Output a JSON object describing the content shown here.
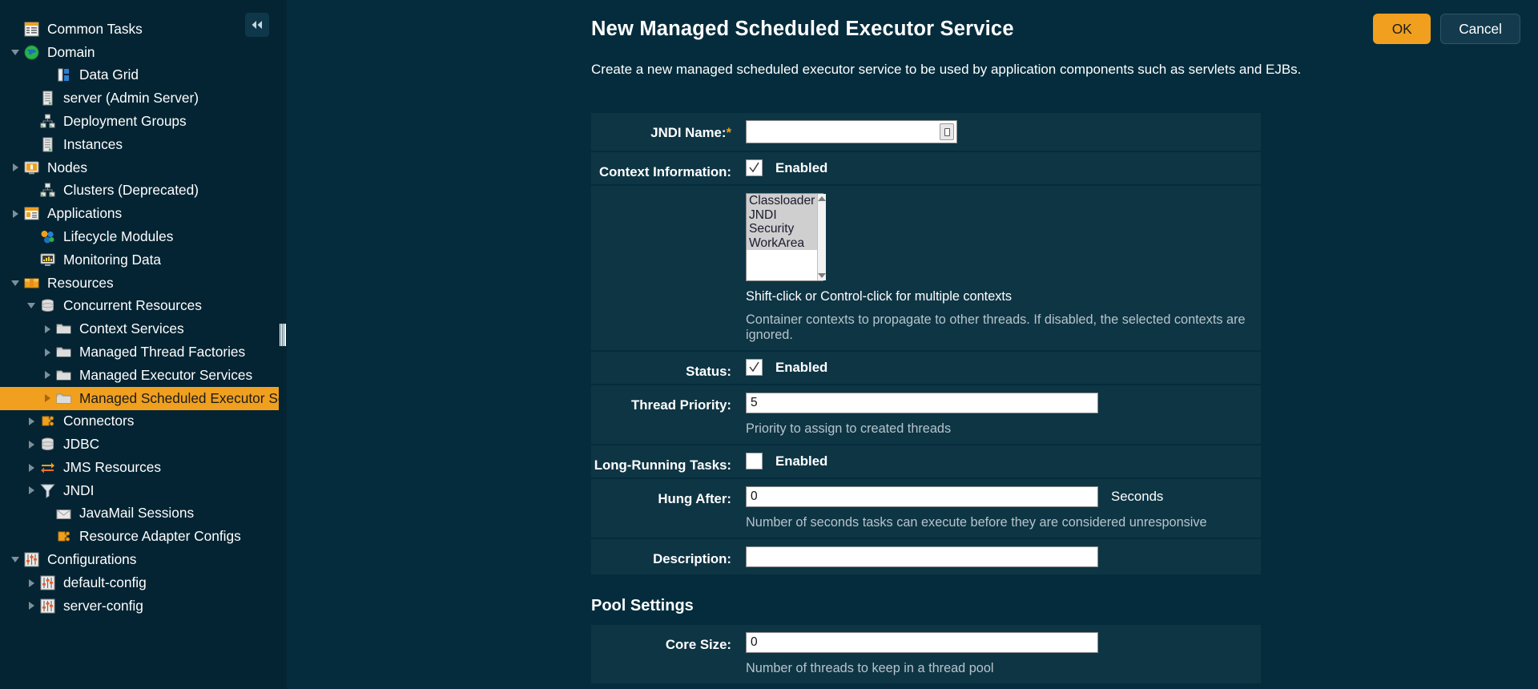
{
  "sidebar": {
    "collapse_icon": "chevron-double-left-icon",
    "items": [
      {
        "label": "Common Tasks",
        "icon": "tasks-icon",
        "indent": 0,
        "twisty": "none",
        "selected": false
      },
      {
        "label": "Domain",
        "icon": "globe-icon",
        "indent": 0,
        "twisty": "expanded",
        "selected": false
      },
      {
        "label": "Data Grid",
        "icon": "datagrid-icon",
        "indent": 2,
        "twisty": "none",
        "selected": false
      },
      {
        "label": "server (Admin Server)",
        "icon": "server-icon",
        "indent": 1,
        "twisty": "none",
        "selected": false
      },
      {
        "label": "Deployment Groups",
        "icon": "group-icon",
        "indent": 1,
        "twisty": "none",
        "selected": false
      },
      {
        "label": "Instances",
        "icon": "server-icon",
        "indent": 1,
        "twisty": "none",
        "selected": false
      },
      {
        "label": "Nodes",
        "icon": "node-icon",
        "indent": 0,
        "twisty": "collapsed",
        "selected": false
      },
      {
        "label": "Clusters (Deprecated)",
        "icon": "group-icon",
        "indent": 1,
        "twisty": "none",
        "selected": false
      },
      {
        "label": "Applications",
        "icon": "application-icon",
        "indent": 0,
        "twisty": "collapsed",
        "selected": false
      },
      {
        "label": "Lifecycle Modules",
        "icon": "lifecycle-icon",
        "indent": 1,
        "twisty": "none",
        "selected": false
      },
      {
        "label": "Monitoring Data",
        "icon": "monitor-icon",
        "indent": 1,
        "twisty": "none",
        "selected": false
      },
      {
        "label": "Resources",
        "icon": "resources-icon",
        "indent": 0,
        "twisty": "expanded",
        "selected": false
      },
      {
        "label": "Concurrent Resources",
        "icon": "database-icon",
        "indent": 1,
        "twisty": "expanded",
        "selected": false
      },
      {
        "label": "Context Services",
        "icon": "folder-icon",
        "indent": 2,
        "twisty": "collapsed",
        "selected": false
      },
      {
        "label": "Managed Thread Factories",
        "icon": "folder-icon",
        "indent": 2,
        "twisty": "collapsed",
        "selected": false
      },
      {
        "label": "Managed Executor Services",
        "icon": "folder-icon",
        "indent": 2,
        "twisty": "collapsed",
        "selected": false
      },
      {
        "label": "Managed Scheduled Executor Services",
        "icon": "folder-icon",
        "indent": 2,
        "twisty": "collapsed",
        "selected": true
      },
      {
        "label": "Connectors",
        "icon": "connector-icon",
        "indent": 1,
        "twisty": "collapsed",
        "selected": false
      },
      {
        "label": "JDBC",
        "icon": "database-icon",
        "indent": 1,
        "twisty": "collapsed",
        "selected": false
      },
      {
        "label": "JMS Resources",
        "icon": "jms-icon",
        "indent": 1,
        "twisty": "collapsed",
        "selected": false
      },
      {
        "label": "JNDI",
        "icon": "funnel-icon",
        "indent": 1,
        "twisty": "collapsed",
        "selected": false
      },
      {
        "label": "JavaMail Sessions",
        "icon": "mail-icon",
        "indent": 2,
        "twisty": "none",
        "selected": false
      },
      {
        "label": "Resource Adapter Configs",
        "icon": "connector-icon",
        "indent": 2,
        "twisty": "none",
        "selected": false
      },
      {
        "label": "Configurations",
        "icon": "config-icon",
        "indent": 0,
        "twisty": "expanded",
        "selected": false
      },
      {
        "label": "default-config",
        "icon": "config-icon",
        "indent": 1,
        "twisty": "collapsed",
        "selected": false
      },
      {
        "label": "server-config",
        "icon": "config-icon",
        "indent": 1,
        "twisty": "collapsed",
        "selected": false
      }
    ]
  },
  "header": {
    "title": "New Managed Scheduled Executor Service",
    "description": "Create a new managed scheduled executor service to be used by application components such as servlets and EJBs.",
    "ok_label": "OK",
    "cancel_label": "Cancel"
  },
  "form": {
    "jndi_name": {
      "label": "JNDI Name:",
      "required_marker": "*",
      "value": "",
      "placeholder": ""
    },
    "context_information": {
      "label": "Context Information:",
      "checkbox_label": "Enabled",
      "checked": true
    },
    "contexts": {
      "options": [
        "Classloader",
        "JNDI",
        "Security",
        "WorkArea"
      ],
      "selected": [
        "Classloader",
        "JNDI",
        "Security",
        "WorkArea"
      ],
      "hint_primary": "Shift-click or Control-click for multiple contexts",
      "hint_secondary": "Container contexts to propagate to other threads. If disabled, the selected contexts are ignored."
    },
    "status": {
      "label": "Status:",
      "checkbox_label": "Enabled",
      "checked": true
    },
    "thread_priority": {
      "label": "Thread Priority:",
      "value": "5",
      "hint": "Priority to assign to created threads"
    },
    "long_running_tasks": {
      "label": "Long-Running Tasks:",
      "checkbox_label": "Enabled",
      "checked": false
    },
    "hung_after": {
      "label": "Hung After:",
      "value": "0",
      "unit": "Seconds",
      "hint": "Number of seconds tasks can execute before they are considered unresponsive"
    },
    "description_field": {
      "label": "Description:",
      "value": ""
    },
    "pool_settings": {
      "heading": "Pool Settings",
      "core_size": {
        "label": "Core Size:",
        "value": "0",
        "hint": "Number of threads to keep in a thread pool"
      }
    }
  },
  "colors": {
    "accent": "#f0a01e",
    "sidebar_bg": "#042433",
    "main_bg": "#042c3c",
    "row_bg": "#0e3544"
  }
}
